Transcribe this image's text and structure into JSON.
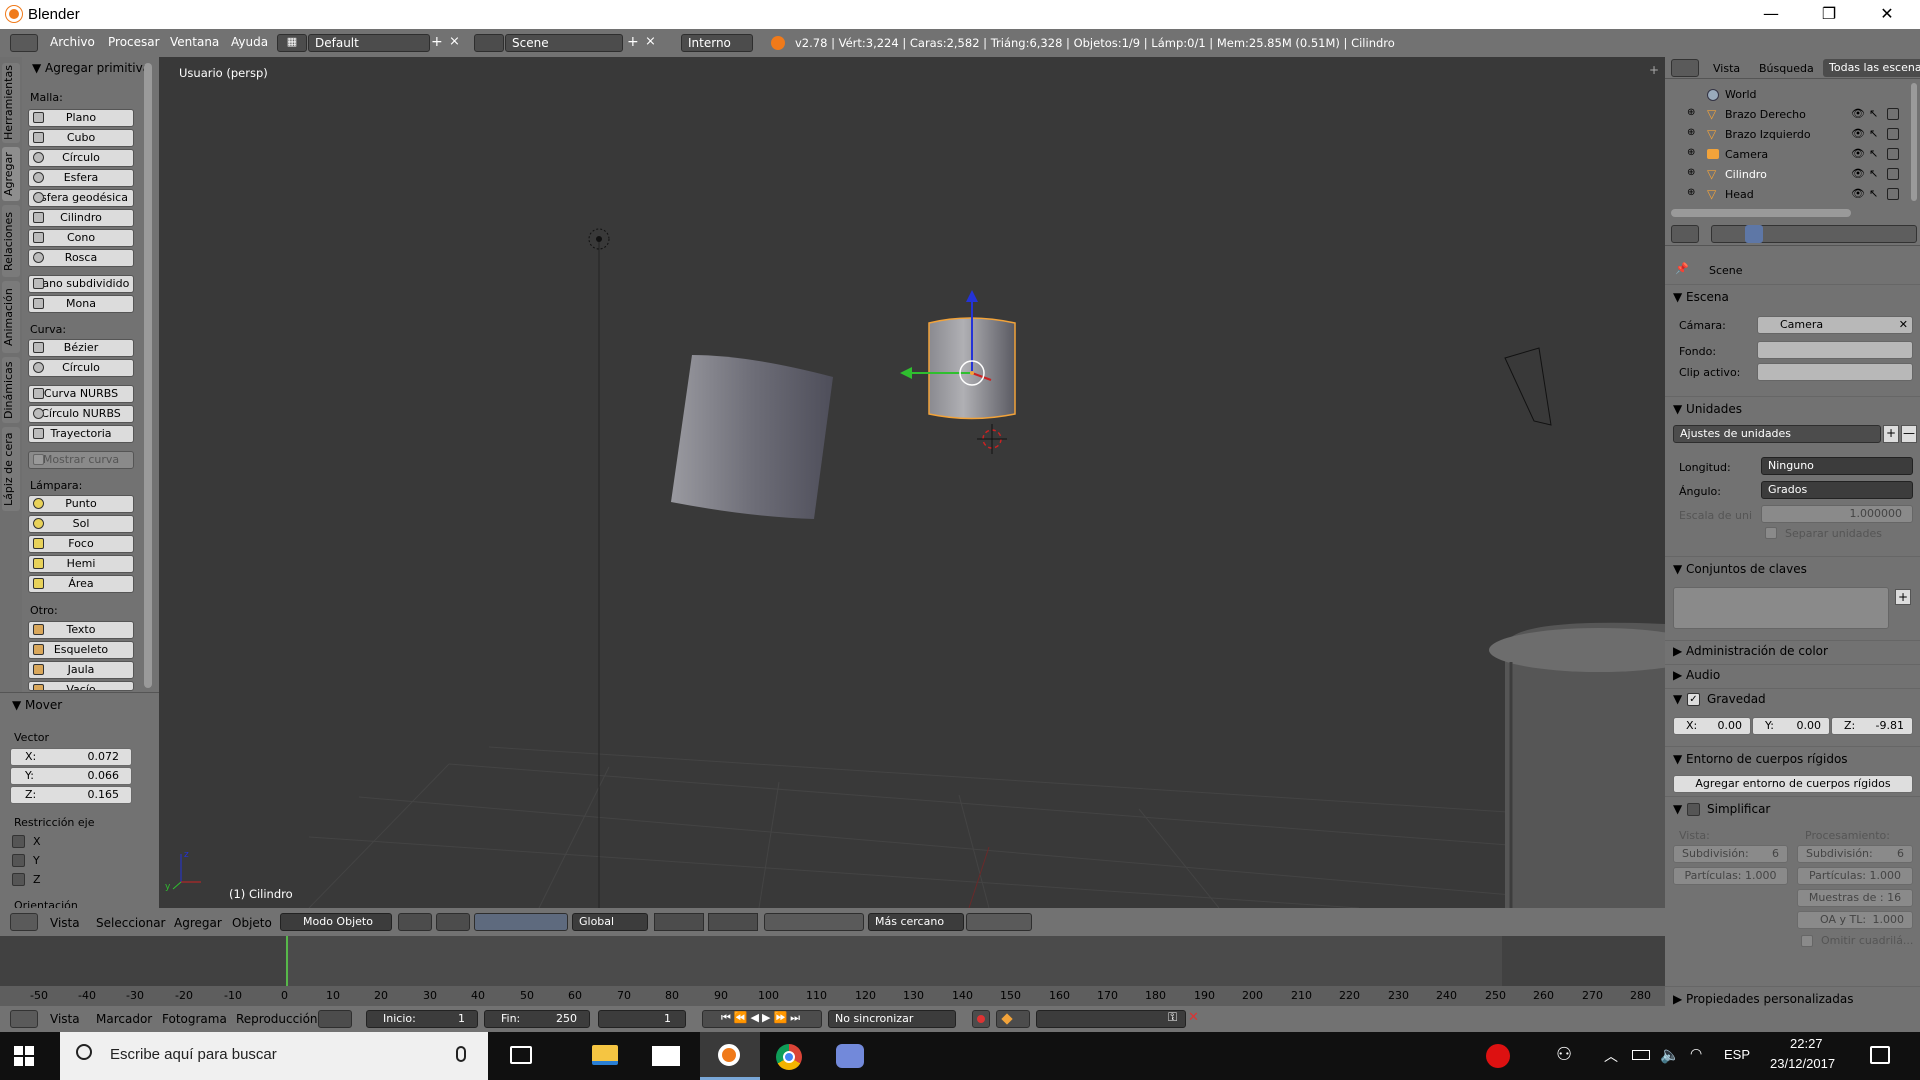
{
  "window": {
    "title": "Blender",
    "minimize": "—",
    "maximize": "❐",
    "close": "✕"
  },
  "infobar": {
    "menus": [
      "Archivo",
      "Procesar",
      "Ventana",
      "Ayuda"
    ],
    "layout": "Default",
    "scene": "Scene",
    "engine": "Interno",
    "stats": "v2.78 | Vért:3,224 | Caras:2,582 | Triáng:6,328 | Objetos:1/9 | Lámp:0/1 | Mem:25.85M (0.51M) | Cilindro"
  },
  "tool_tabs": [
    "Herramientas",
    "Agregar",
    "Relaciones",
    "Animación",
    "Dinámicas",
    "Lápiz de cera"
  ],
  "toolshelf": {
    "panel_title": "Agregar primitiva",
    "malla_label": "Malla:",
    "malla": [
      "Plano",
      "Cubo",
      "Círculo",
      "Esfera",
      "Esfera geodésica",
      "Cilindro",
      "Cono",
      "Rosca"
    ],
    "malla2": [
      "Plano subdividido",
      "Mona"
    ],
    "curva_label": "Curva:",
    "curva": [
      "Bézier",
      "Círculo"
    ],
    "curva2": [
      "Curva NURBS",
      "Círculo NURBS",
      "Trayectoria"
    ],
    "mostrar_curva": "Mostrar curva",
    "lampara_label": "Lámpara:",
    "lampara": [
      "Punto",
      "Sol",
      "Foco",
      "Hemi",
      "Área"
    ],
    "otro_label": "Otro:",
    "otro": [
      "Texto",
      "Esqueleto",
      "Jaula",
      "Vacío"
    ]
  },
  "operator": {
    "title": "Mover",
    "vector_label": "Vector",
    "x_label": "X:",
    "x": "0.072",
    "y_label": "Y:",
    "y": "0.066",
    "z_label": "Z:",
    "z": "0.165",
    "restriccion_label": "Restricción eje",
    "axes": [
      "X",
      "Y",
      "Z"
    ],
    "orientacion": "Orientación"
  },
  "viewport": {
    "view_label": "Usuario (persp)",
    "object_label": "(1) Cilindro"
  },
  "view3d_header": {
    "menus": [
      "Vista",
      "Seleccionar",
      "Agregar",
      "Objeto"
    ],
    "mode": "Modo Objeto",
    "orientation": "Global",
    "snap": "Más cercano"
  },
  "timeline": {
    "ticks": [
      "-50",
      "-40",
      "-30",
      "-20",
      "-10",
      "0",
      "10",
      "20",
      "30",
      "40",
      "50",
      "60",
      "70",
      "80",
      "90",
      "100",
      "110",
      "120",
      "130",
      "140",
      "150",
      "160",
      "170",
      "180",
      "190",
      "200",
      "210",
      "220",
      "230",
      "240",
      "250",
      "260",
      "270",
      "280"
    ],
    "menus": [
      "Vista",
      "Marcador",
      "Fotograma",
      "Reproducción"
    ],
    "start_label": "Inicio:",
    "start": "1",
    "end_label": "Fin:",
    "end": "250",
    "current": "1",
    "sync": "No sincronizar"
  },
  "outliner": {
    "tabs": [
      "Vista",
      "Búsqueda",
      "Todas las escenas"
    ],
    "items": [
      "World",
      "Brazo Derecho",
      "Brazo Izquierdo",
      "Camera",
      "Cilindro",
      "Head"
    ]
  },
  "properties": {
    "context": "Scene",
    "escena": {
      "title": "Escena",
      "camara_label": "Cámara:",
      "camara": "Camera",
      "fondo_label": "Fondo:",
      "clip_label": "Clip activo:"
    },
    "unidades": {
      "title": "Unidades",
      "preset": "Ajustes de unidades",
      "longitud_label": "Longitud:",
      "longitud": "Ninguno",
      "angulo_label": "Ángulo:",
      "angulo": "Grados",
      "escala_label": "Escala de uni",
      "escala": "1.000000",
      "separar": "Separar unidades"
    },
    "claves_title": "Conjuntos de claves",
    "color_title": "Administración de color",
    "audio_title": "Audio",
    "gravedad": {
      "title": "Gravedad",
      "x_label": "X:",
      "x": "0.00",
      "y_label": "Y:",
      "y": "0.00",
      "z_label": "Z:",
      "z": "-9.81"
    },
    "rigid": {
      "title": "Entorno de cuerpos rígidos",
      "button": "Agregar entorno de cuerpos rígidos"
    },
    "simplificar": {
      "title": "Simplificar",
      "vista_label": "Vista:",
      "proc_label": "Procesamiento:",
      "sub_label": "Subdivisión:",
      "sub_vista": "6",
      "sub_proc": "6",
      "part_label": "Partículas:",
      "part_vista": "1.000",
      "part_proc": "1.000",
      "muestras_label": "Muestras de :",
      "muestras": "16",
      "oa_label": "OA y TL:",
      "oa": "1.000",
      "omitir": "Omitir cuadrilá..."
    },
    "custom_title": "Propiedades personalizadas"
  },
  "taskbar": {
    "search_placeholder": "Escribe aquí para buscar",
    "lang": "ESP",
    "time": "22:27",
    "date": "23/12/2017"
  }
}
